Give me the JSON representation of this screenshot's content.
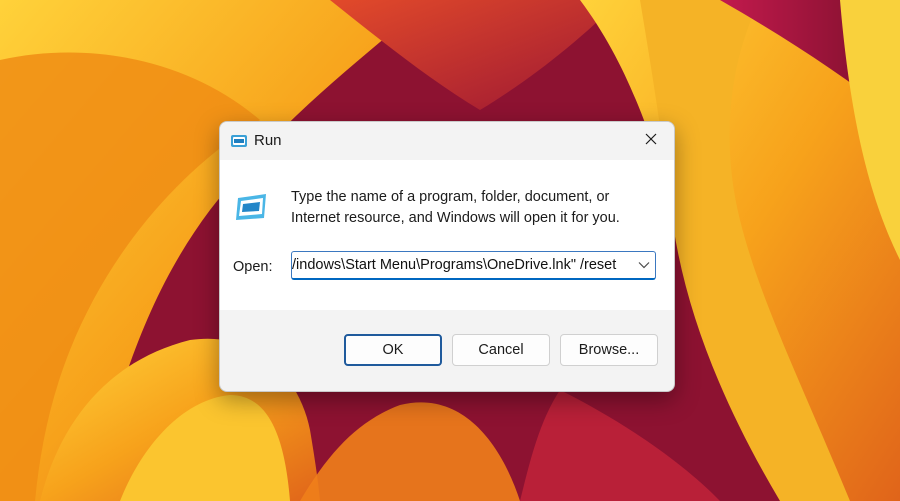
{
  "dialog": {
    "title": "Run",
    "title_icon": "run-app-icon",
    "close_icon": "close-icon",
    "description": "Type the name of a program, folder, document, or Internet resource, and Windows will open it for you.",
    "open_label": "Open:",
    "open_value": "/indows\\Start Menu\\Programs\\OneDrive.lnk\" /reset",
    "dropdown_icon": "chevron-down-icon",
    "buttons": {
      "ok": "OK",
      "cancel": "Cancel",
      "browse": "Browse..."
    }
  },
  "colors": {
    "accent": "#0067c0",
    "wallpaper_primary": "#f5a51c",
    "wallpaper_secondary": "#8a1430"
  }
}
